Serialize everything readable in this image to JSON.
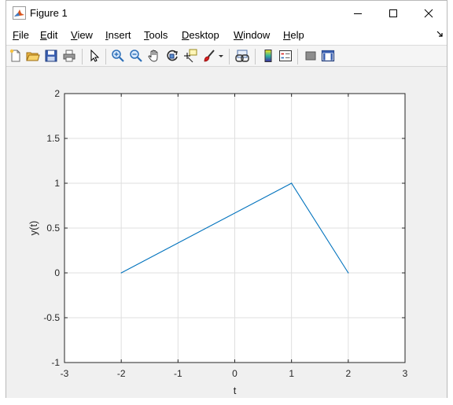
{
  "window": {
    "title": "Figure 1"
  },
  "menu": {
    "items": [
      {
        "mnemonic": "F",
        "rest": "ile"
      },
      {
        "mnemonic": "E",
        "rest": "dit"
      },
      {
        "mnemonic": "V",
        "rest": "iew"
      },
      {
        "mnemonic": "I",
        "rest": "nsert"
      },
      {
        "mnemonic": "T",
        "rest": "ools"
      },
      {
        "mnemonic": "D",
        "rest": "esktop"
      },
      {
        "mnemonic": "W",
        "rest": "indow"
      },
      {
        "mnemonic": "H",
        "rest": "elp"
      }
    ]
  },
  "toolbar": {
    "icons": [
      "new-figure-icon",
      "open-file-icon",
      "save-icon",
      "print-icon",
      "pointer-icon",
      "zoom-in-icon",
      "zoom-out-icon",
      "pan-hand-icon",
      "rotate-3d-icon",
      "data-cursor-icon",
      "brush-icon",
      "brush-dropdown-icon",
      "link-plot-icon",
      "colorbar-icon",
      "legend-icon",
      "hide-plot-tools-icon",
      "show-plot-tools-icon"
    ]
  },
  "chart_data": {
    "type": "line",
    "xlabel": "t",
    "ylabel": "y(t)",
    "xlim": [
      -3,
      3
    ],
    "ylim": [
      -1,
      2
    ],
    "xticks": [
      "-3",
      "-2",
      "-1",
      "0",
      "1",
      "2",
      "3"
    ],
    "yticks": [
      "-1",
      "-0.5",
      "0",
      "0.5",
      "1",
      "1.5",
      "2"
    ],
    "grid": true,
    "series": [
      {
        "x": [
          -2,
          1,
          2
        ],
        "y": [
          0,
          1,
          0
        ],
        "color": "#0072bd"
      }
    ]
  }
}
